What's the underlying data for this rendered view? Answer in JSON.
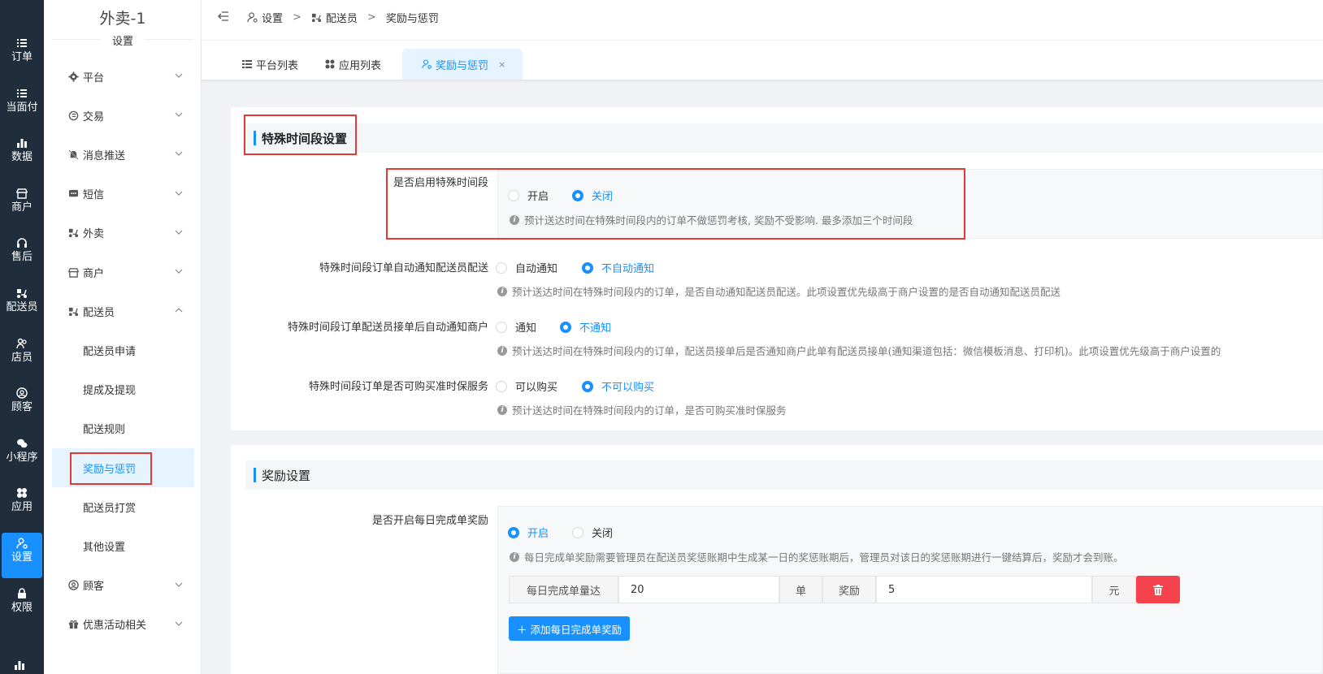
{
  "rail": {
    "items": [
      {
        "label": "订单",
        "icon": "list-icon"
      },
      {
        "label": "当面付",
        "icon": "list-icon"
      },
      {
        "label": "数据",
        "icon": "bar-chart-icon"
      },
      {
        "label": "商户",
        "icon": "shop-icon"
      },
      {
        "label": "售后",
        "icon": "headset-icon"
      },
      {
        "label": "配送员",
        "icon": "scooter-icon"
      },
      {
        "label": "店员",
        "icon": "users-icon"
      },
      {
        "label": "顾客",
        "icon": "user-circle-icon"
      },
      {
        "label": "小程序",
        "icon": "wechat-icon"
      },
      {
        "label": "应用",
        "icon": "apps-icon"
      },
      {
        "label": "设置",
        "icon": "user-gear-icon"
      },
      {
        "label": "权限",
        "icon": "lock-icon"
      }
    ],
    "active_index": 10
  },
  "sidebar": {
    "title": "外卖-1",
    "subtitle": "设置",
    "menu": [
      {
        "label": "平台",
        "icon": "gear-icon"
      },
      {
        "label": "交易",
        "icon": "trade-icon"
      },
      {
        "label": "消息推送",
        "icon": "bell-off-icon"
      },
      {
        "label": "短信",
        "icon": "message-icon"
      },
      {
        "label": "外卖",
        "icon": "scooter-icon"
      },
      {
        "label": "商户",
        "icon": "shop-icon"
      },
      {
        "label": "配送员",
        "icon": "scooter-icon"
      }
    ],
    "submenu": [
      "配送员申请",
      "提成及提现",
      "配送规则",
      "奖励与惩罚",
      "配送员打赏",
      "其他设置"
    ],
    "menu_after": [
      {
        "label": "顾客",
        "icon": "user-circle-icon"
      },
      {
        "label": "优惠活动相关",
        "icon": "gift-icon"
      }
    ],
    "active_sub": "奖励与惩罚"
  },
  "breadcrumb": [
    "设置",
    "配送员",
    "奖励与惩罚"
  ],
  "tabs": [
    {
      "label": "平台列表",
      "icon": "list-icon"
    },
    {
      "label": "应用列表",
      "icon": "apps-icon"
    },
    {
      "label": "奖励与惩罚",
      "icon": "user-gear-icon",
      "close": "×"
    }
  ],
  "section1": {
    "title": "特殊时间段设置",
    "rows": [
      {
        "label": "是否启用特殊时间段",
        "options": [
          "开启",
          "关闭"
        ],
        "selected": "关闭",
        "hint": "预计送达时间在特殊时间段内的订单不做惩罚考核, 奖励不受影响. 最多添加三个时间段"
      },
      {
        "label": "特殊时间段订单自动通知配送员配送",
        "options": [
          "自动通知",
          "不自动通知"
        ],
        "selected": "不自动通知",
        "hint": "预计送达时间在特殊时间段内的订单，是否自动通知配送员配送。此项设置优先级高于商户设置的是否自动通知配送员配送"
      },
      {
        "label": "特殊时间段订单配送员接单后自动通知商户",
        "options": [
          "通知",
          "不通知"
        ],
        "selected": "不通知",
        "hint": "预计送达时间在特殊时间段内的订单，配送员接单后是否通知商户此单有配送员接单(通知渠道包括：微信模板消息、打印机)。此项设置优先级高于商户设置的"
      },
      {
        "label": "特殊时间段订单是否可购买准时保服务",
        "options": [
          "可以购买",
          "不可以购买"
        ],
        "selected": "不可以购买",
        "hint": "预计送达时间在特殊时间段内的订单，是否可购买准时保服务"
      }
    ]
  },
  "section2": {
    "title": "奖励设置",
    "row": {
      "label": "是否开启每日完成单奖励",
      "options": [
        "开启",
        "关闭"
      ],
      "selected": "开启",
      "hint": "每日完成单奖励需要管理员在配送员奖惩账期中生成某一日的奖惩账期后，管理员对该日的奖惩账期进行一键结算后，奖励才会到账。"
    },
    "reward": {
      "prefix": "每日完成单量达",
      "count": "20",
      "unit1": "单",
      "mid": "奖励",
      "amount": "5",
      "unit2": "元"
    },
    "add_button": "添加每日完成单奖励"
  },
  "colors": {
    "accent": "#1890ff",
    "rail_bg": "#1f2d3d",
    "danger": "#f5424d",
    "highlight_box": "#e53935"
  }
}
